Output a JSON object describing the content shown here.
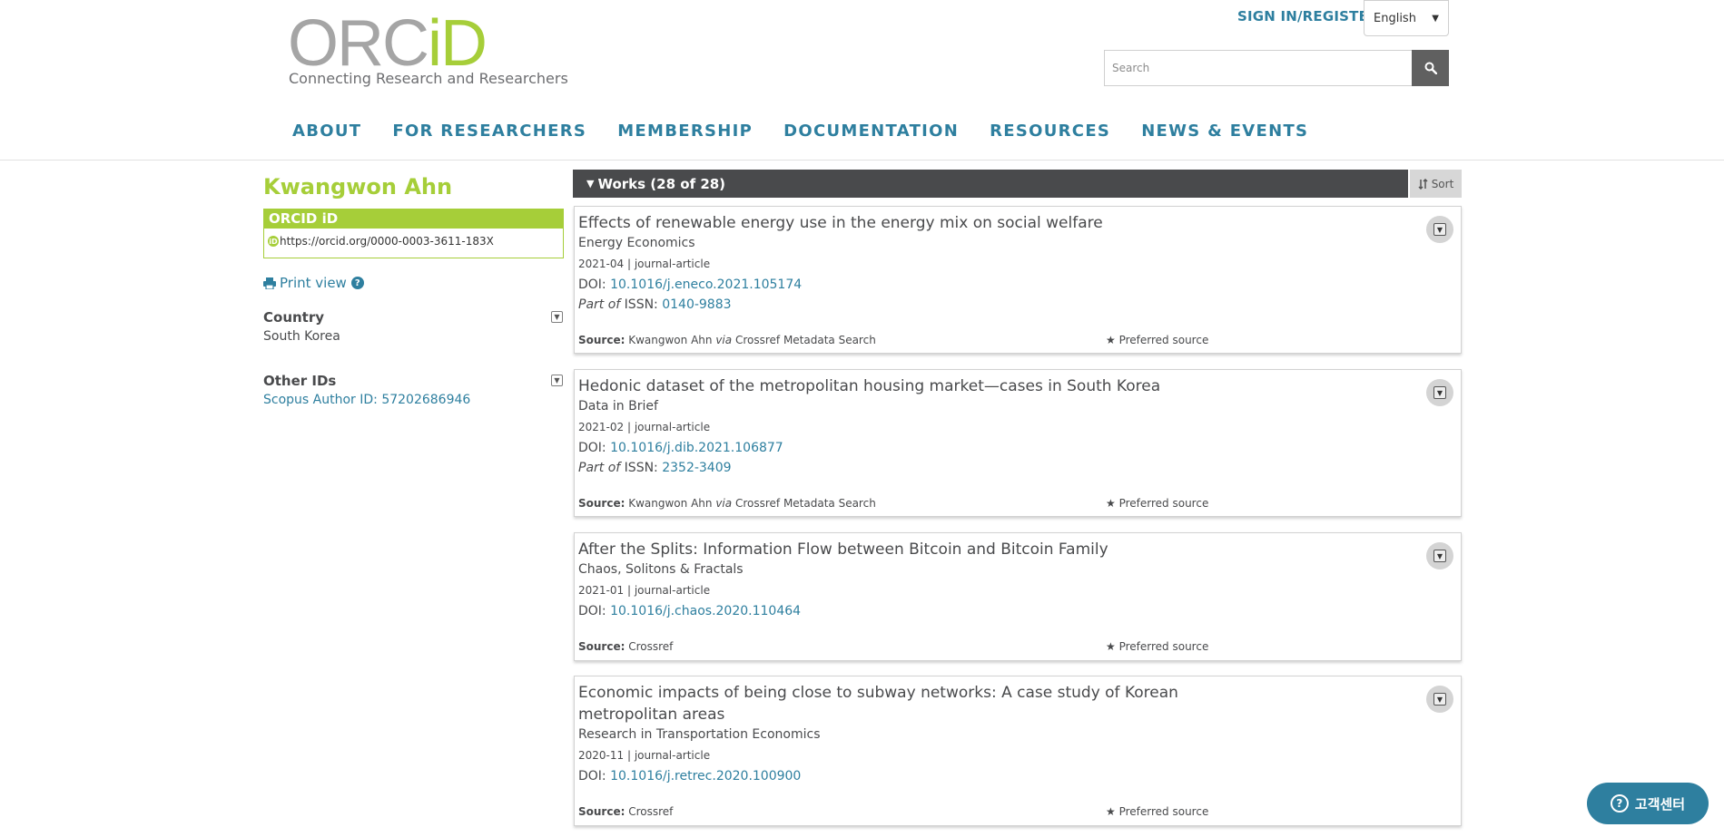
{
  "header": {
    "logo_word_main": "ORC",
    "logo_word_accent": "iD",
    "logo_tagline": "Connecting Research and Researchers",
    "signin_label": "SIGN IN/REGISTER",
    "language": {
      "selected": "English"
    },
    "search": {
      "placeholder": "Search"
    },
    "nav": [
      {
        "label": "ABOUT"
      },
      {
        "label": "FOR RESEARCHERS"
      },
      {
        "label": "MEMBERSHIP"
      },
      {
        "label": "DOCUMENTATION"
      },
      {
        "label": "RESOURCES"
      },
      {
        "label": "NEWS & EVENTS"
      }
    ]
  },
  "profile": {
    "name": "Kwangwon Ahn",
    "orcid_heading": "ORCID iD",
    "orcid_url": "https://orcid.org/0000-0003-3611-183X",
    "print_view_label": "Print view",
    "country_label": "Country",
    "country_value": "South Korea",
    "other_ids_label": "Other IDs",
    "other_ids_value": "Scopus Author ID: 57202686946"
  },
  "works": {
    "heading": "Works (28 of 28)",
    "sort_label": "Sort",
    "items": [
      {
        "title": "Effects of renewable energy use in the energy mix on social welfare",
        "journal": "Energy Economics",
        "date": "2021-04",
        "type": "journal-article",
        "doi_label": "DOI:",
        "doi": "10.1016/j.eneco.2021.105174",
        "part_of": "Part of",
        "issn_label": "ISSN:",
        "issn": "0140-9883",
        "source_label": "Source:",
        "source_name": "Kwangwon Ahn",
        "source_via": "via",
        "source_tool": "Crossref Metadata Search",
        "preferred": "Preferred source"
      },
      {
        "title": "Hedonic dataset of the metropolitan housing market—cases in South Korea",
        "journal": "Data in Brief",
        "date": "2021-02",
        "type": "journal-article",
        "doi_label": "DOI:",
        "doi": "10.1016/j.dib.2021.106877",
        "part_of": "Part of",
        "issn_label": "ISSN:",
        "issn": "2352-3409",
        "source_label": "Source:",
        "source_name": "Kwangwon Ahn",
        "source_via": "via",
        "source_tool": "Crossref Metadata Search",
        "preferred": "Preferred source"
      },
      {
        "title": "After the Splits: Information Flow between Bitcoin and Bitcoin Family",
        "journal": "Chaos, Solitons & Fractals",
        "date": "2021-01",
        "type": "journal-article",
        "doi_label": "DOI:",
        "doi": "10.1016/j.chaos.2020.110464",
        "source_label": "Source:",
        "source_name": "Crossref",
        "preferred": "Preferred source"
      },
      {
        "title": "Economic impacts of being close to subway networks: A case study of Korean metropolitan areas",
        "journal": "Research in Transportation Economics",
        "date": "2020-11",
        "type": "journal-article",
        "doi_label": "DOI:",
        "doi": "10.1016/j.retrec.2020.100900",
        "source_label": "Source:",
        "source_name": "Crossref",
        "preferred": "Preferred source"
      }
    ]
  },
  "help_widget": {
    "label": "고객센터"
  },
  "colors": {
    "orcid_green": "#a6ce39",
    "link_blue": "#2e7f9f",
    "works_bar": "#494a4c",
    "logo_grey": "#a5a5a5"
  }
}
